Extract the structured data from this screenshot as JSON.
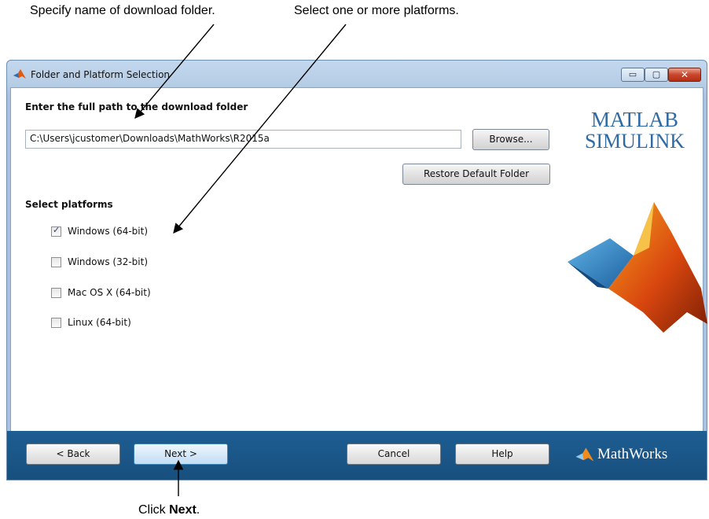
{
  "annotations": {
    "folder": "Specify name of download folder.",
    "platforms": "Select one or more platforms.",
    "click_prefix": "Click ",
    "click_strong": "Next",
    "click_suffix": "."
  },
  "window": {
    "title": "Folder and Platform Selection",
    "controls": {
      "minimize": "▭",
      "maximize": "▢",
      "close": "✕"
    }
  },
  "folder": {
    "label": "Enter the full path to the download folder",
    "path_value": "C:\\Users\\jcustomer\\Downloads\\MathWorks\\R2015a",
    "browse_label": "Browse...",
    "restore_label": "Restore Default Folder"
  },
  "platforms": {
    "label": "Select platforms",
    "items": [
      {
        "label": "Windows (64-bit)",
        "checked": true
      },
      {
        "label": "Windows (32-bit)",
        "checked": false
      },
      {
        "label": "Mac OS X (64-bit)",
        "checked": false
      },
      {
        "label": "Linux (64-bit)",
        "checked": false
      }
    ]
  },
  "branding": {
    "matlab": "MATLAB",
    "simulink": "SIMULINK",
    "mathworks": "MathWorks"
  },
  "footer": {
    "back_label": "< Back",
    "next_label": "Next >",
    "cancel_label": "Cancel",
    "help_label": "Help"
  },
  "colors": {
    "footer_blue": "#1a5688",
    "logo_blue": "#2e6aa4",
    "close_red": "#c9462c"
  },
  "icons": {
    "title": "matlab-membrane-icon",
    "checkbox_checked": "checkmark-icon",
    "footer_logo": "mathworks-logo-icon"
  }
}
